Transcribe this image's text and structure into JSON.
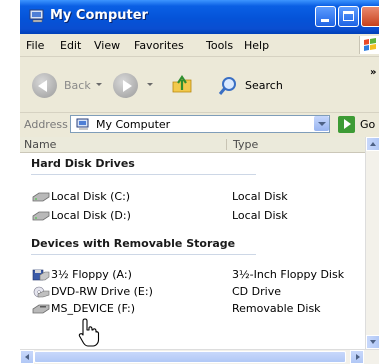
{
  "window": {
    "title": "My Computer"
  },
  "menu": [
    "File",
    "Edit",
    "View",
    "Favorites",
    "Tools",
    "Help"
  ],
  "toolbar": {
    "back_label": "Back",
    "search_label": "Search",
    "more": "»"
  },
  "address": {
    "label": "Address",
    "value": "My Computer",
    "go_label": "Go"
  },
  "columns": {
    "name": "Name",
    "type": "Type"
  },
  "groups": [
    {
      "title": "Hard Disk Drives",
      "items": [
        {
          "name": "Local Disk (C:)",
          "type": "Local Disk",
          "icon": "hard-disk-icon"
        },
        {
          "name": "Local Disk (D:)",
          "type": "Local Disk",
          "icon": "hard-disk-icon"
        }
      ]
    },
    {
      "title": "Devices with Removable Storage",
      "items": [
        {
          "name": "3½ Floppy (A:)",
          "type": "3½-Inch Floppy Disk",
          "icon": "floppy-drive-icon"
        },
        {
          "name": "DVD-RW Drive (E:)",
          "type": "CD Drive",
          "icon": "dvd-drive-icon"
        },
        {
          "name": "MS_DEVICE (F:)",
          "type": "Removable Disk",
          "icon": "removable-disk-icon"
        }
      ]
    }
  ],
  "colors": {
    "titlebar": "#0553d8",
    "chrome": "#ece9d8",
    "group_line": "#cdd7e6"
  }
}
